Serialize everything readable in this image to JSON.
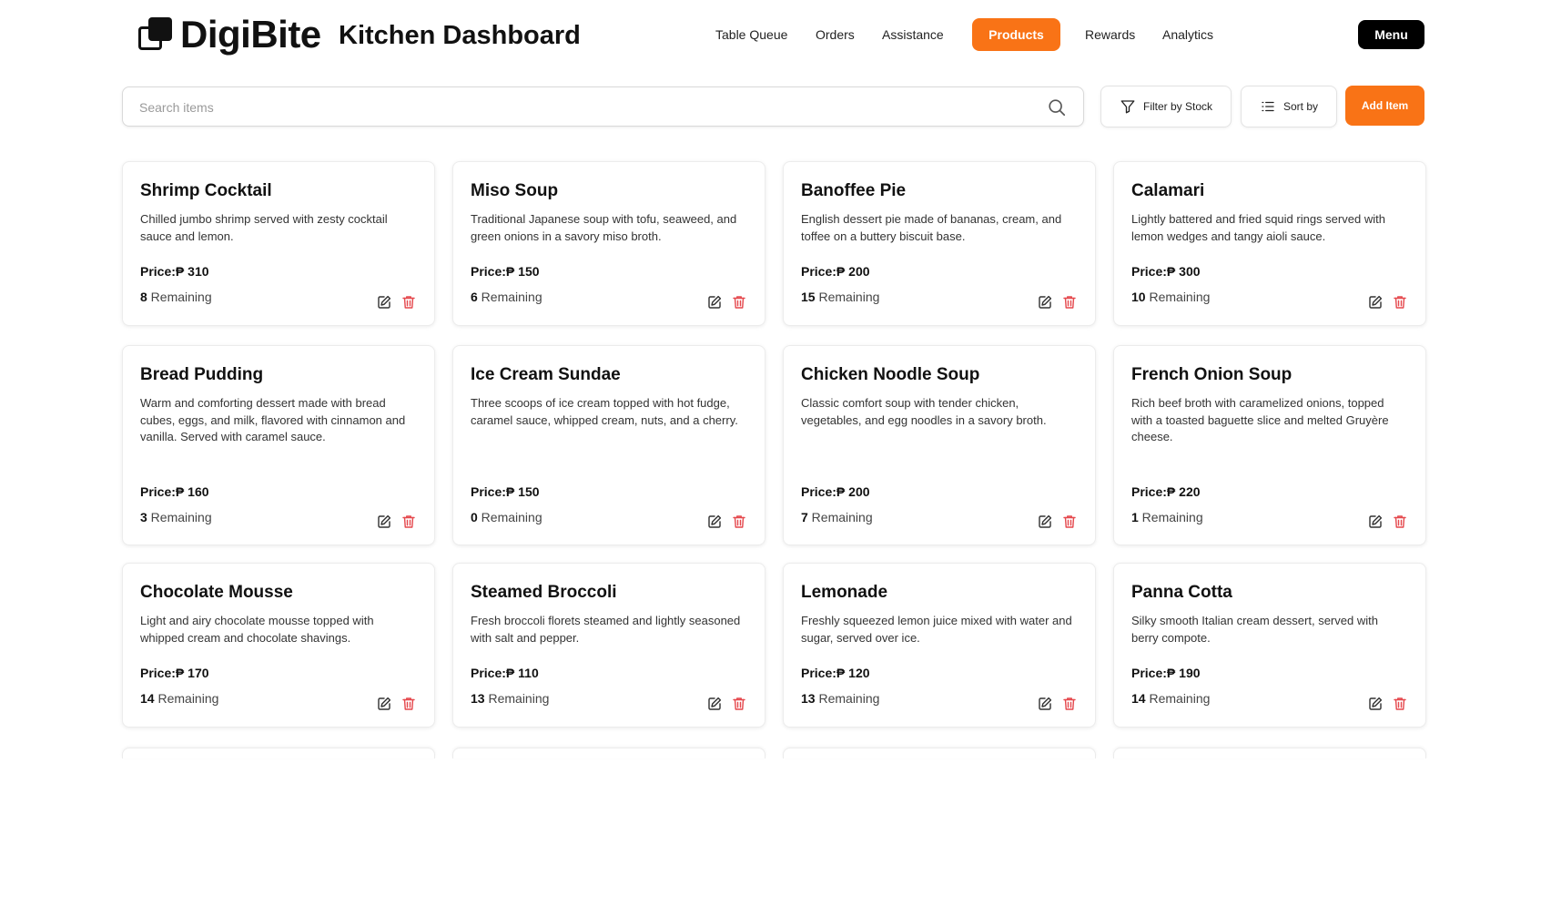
{
  "app": {
    "brand_name": "DigiBite",
    "page_title": "Kitchen Dashboard"
  },
  "nav": {
    "items": [
      {
        "label": "Table Queue",
        "active": false
      },
      {
        "label": "Orders",
        "active": false
      },
      {
        "label": "Assistance",
        "active": false
      },
      {
        "label": "Products",
        "active": true
      },
      {
        "label": "Rewards",
        "active": false
      },
      {
        "label": "Analytics",
        "active": false
      }
    ],
    "menu_label": "Menu"
  },
  "toolbar": {
    "search_placeholder": "Search items",
    "search_value": "",
    "filter_label": "Filter by Stock",
    "sort_label": "Sort by",
    "add_label": "Add Item"
  },
  "labels": {
    "price_prefix": "Price:",
    "currency": "₱",
    "remaining_suffix": "Remaining"
  },
  "colors": {
    "accent": "#f97316",
    "delete": "#e5484d",
    "menu_bg": "#000000"
  },
  "products": [
    {
      "name": "Shrimp Cocktail",
      "description": "Chilled jumbo shrimp served with zesty cocktail sauce and lemon.",
      "price": "310",
      "remaining": "8"
    },
    {
      "name": "Miso Soup",
      "description": "Traditional Japanese soup with tofu, seaweed, and green onions in a savory miso broth.",
      "price": "150",
      "remaining": "6"
    },
    {
      "name": "Banoffee Pie",
      "description": "English dessert pie made of bananas, cream, and toffee on a buttery biscuit base.",
      "price": "200",
      "remaining": "15"
    },
    {
      "name": "Calamari",
      "description": "Lightly battered and fried squid rings served with lemon wedges and tangy aioli sauce.",
      "price": "300",
      "remaining": "10"
    },
    {
      "name": "Bread Pudding",
      "description": "Warm and comforting dessert made with bread cubes, eggs, and milk, flavored with cinnamon and vanilla. Served with caramel sauce.",
      "price": "160",
      "remaining": "3"
    },
    {
      "name": "Ice Cream Sundae",
      "description": "Three scoops of ice cream topped with hot fudge, caramel sauce, whipped cream, nuts, and a cherry.",
      "price": "150",
      "remaining": "0"
    },
    {
      "name": "Chicken Noodle Soup",
      "description": "Classic comfort soup with tender chicken, vegetables, and egg noodles in a savory broth.",
      "price": "200",
      "remaining": "7"
    },
    {
      "name": "French Onion Soup",
      "description": "Rich beef broth with caramelized onions, topped with a toasted baguette slice and melted Gruyère cheese.",
      "price": "220",
      "remaining": "1"
    },
    {
      "name": "Chocolate Mousse",
      "description": "Light and airy chocolate mousse topped with whipped cream and chocolate shavings.",
      "price": "170",
      "remaining": "14"
    },
    {
      "name": "Steamed Broccoli",
      "description": "Fresh broccoli florets steamed and lightly seasoned with salt and pepper.",
      "price": "110",
      "remaining": "13"
    },
    {
      "name": "Lemonade",
      "description": "Freshly squeezed lemon juice mixed with water and sugar, served over ice.",
      "price": "120",
      "remaining": "13"
    },
    {
      "name": "Panna Cotta",
      "description": "Silky smooth Italian cream dessert, served with berry compote.",
      "price": "190",
      "remaining": "14"
    }
  ]
}
